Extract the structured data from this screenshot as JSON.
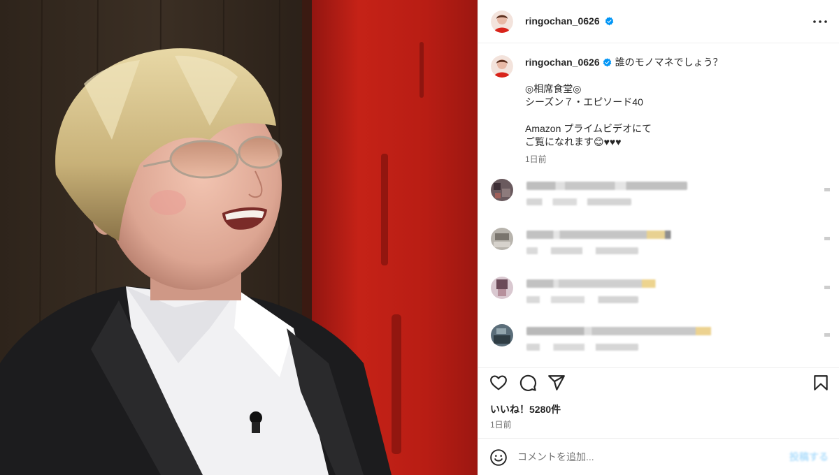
{
  "post": {
    "image_alt": "相席食堂 シーズン7 エピソード40 出演者の写真",
    "header": {
      "username": "ringochan_0626",
      "verified": true,
      "more_icon": "more-horizontal-icon"
    },
    "caption": {
      "username": "ringochan_0626",
      "first_line": "誰のモノマネでしょう？",
      "lines": [
        "◎相席食堂◎",
        "シーズン７・エピソード40",
        "",
        "Amazon プライムビデオにて",
        "ご覧になれます😊♥♥♥"
      ],
      "time": "1日前"
    },
    "comments": [
      {
        "username": "[blurred]",
        "text": "[blurred]",
        "meta": "[blurred]"
      },
      {
        "username": "[blurred]",
        "text": "[blurred]",
        "meta": "[blurred]"
      },
      {
        "username": "[blurred]",
        "text": "[blurred]",
        "meta": "[blurred]"
      },
      {
        "username": "[blurred]",
        "text": "[blurred]",
        "meta": "[blurred]"
      }
    ],
    "actions": {
      "like_icon": "heart-icon",
      "comment_icon": "comment-bubble-icon",
      "share_icon": "paper-plane-icon",
      "save_icon": "bookmark-icon"
    },
    "likes_text": "いいね！5280件",
    "time": "1日前",
    "comment_box": {
      "emoji_icon": "smiley-icon",
      "placeholder": "コメントを追加...",
      "value": "",
      "post_label": "投稿する"
    },
    "colors": {
      "verified": "#0095f6",
      "secondary_text": "#737373",
      "post_button_disabled": "#b2dffc",
      "border": "#efefef"
    }
  }
}
